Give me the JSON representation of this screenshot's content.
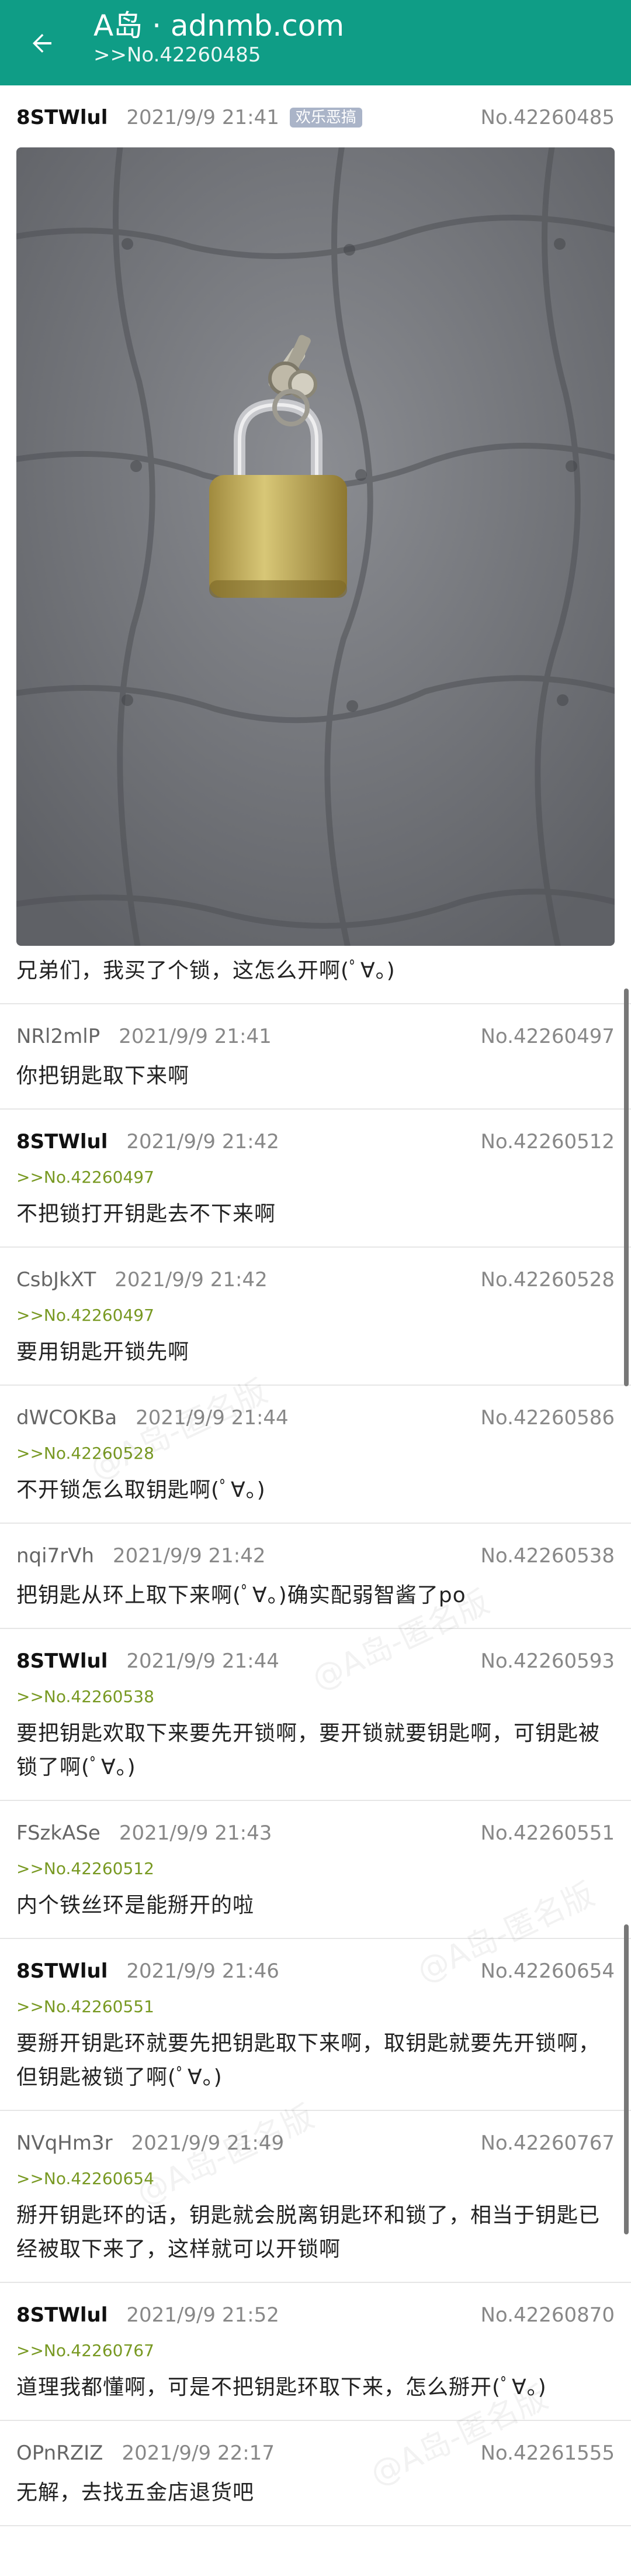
{
  "header": {
    "title": "A岛 · adnmb.com",
    "subtitle": ">>No.42260485"
  },
  "watermark": "@A岛-匿名版",
  "op": {
    "uid": "8STWlul",
    "time": "2021/9/9 21:41",
    "tag": "欢乐恶搞",
    "no": "No.42260485",
    "content": "兄弟们，我买了个锁，这怎么开啊(ﾟ∀。)"
  },
  "replies": [
    {
      "uid": "NRl2mlP",
      "po": false,
      "time": "2021/9/9 21:41",
      "no": "No.42260497",
      "ref": "",
      "content": "你把钥匙取下来啊"
    },
    {
      "uid": "8STWlul",
      "po": true,
      "time": "2021/9/9 21:42",
      "no": "No.42260512",
      "ref": ">>No.42260497",
      "content": "不把锁打开钥匙去不下来啊"
    },
    {
      "uid": "CsbJkXT",
      "po": false,
      "time": "2021/9/9 21:42",
      "no": "No.42260528",
      "ref": ">>No.42260497",
      "content": "要用钥匙开锁先啊"
    },
    {
      "uid": "dWCOKBa",
      "po": false,
      "time": "2021/9/9 21:44",
      "no": "No.42260586",
      "ref": ">>No.42260528",
      "content": "不开锁怎么取钥匙啊(ﾟ∀。)"
    },
    {
      "uid": "nqi7rVh",
      "po": false,
      "time": "2021/9/9 21:42",
      "no": "No.42260538",
      "ref": "",
      "content": "把钥匙从环上取下来啊(ﾟ∀。)确实配弱智酱了po"
    },
    {
      "uid": "8STWlul",
      "po": true,
      "time": "2021/9/9 21:44",
      "no": "No.42260593",
      "ref": ">>No.42260538",
      "content": "要把钥匙欢取下来要先开锁啊，要开锁就要钥匙啊，可钥匙被锁了啊(ﾟ∀。)"
    },
    {
      "uid": "FSzkASe",
      "po": false,
      "time": "2021/9/9 21:43",
      "no": "No.42260551",
      "ref": ">>No.42260512",
      "content": "内个铁丝环是能掰开的啦"
    },
    {
      "uid": "8STWlul",
      "po": true,
      "time": "2021/9/9 21:46",
      "no": "No.42260654",
      "ref": ">>No.42260551",
      "content": "要掰开钥匙环就要先把钥匙取下来啊，取钥匙就要先开锁啊，但钥匙被锁了啊(ﾟ∀。)"
    },
    {
      "uid": "NVqHm3r",
      "po": false,
      "time": "2021/9/9 21:49",
      "no": "No.42260767",
      "ref": ">>No.42260654",
      "content": "掰开钥匙环的话，钥匙就会脱离钥匙环和锁了，相当于钥匙已经被取下来了，这样就可以开锁啊"
    },
    {
      "uid": "8STWlul",
      "po": true,
      "time": "2021/9/9 21:52",
      "no": "No.42260870",
      "ref": ">>No.42260767",
      "content": "道理我都懂啊，可是不把钥匙环取下来，怎么掰开(ﾟ∀。)"
    },
    {
      "uid": "OPnRZIZ",
      "po": false,
      "time": "2021/9/9 22:17",
      "no": "No.42261555",
      "ref": "",
      "content": "无解，去找五金店退货吧"
    }
  ]
}
